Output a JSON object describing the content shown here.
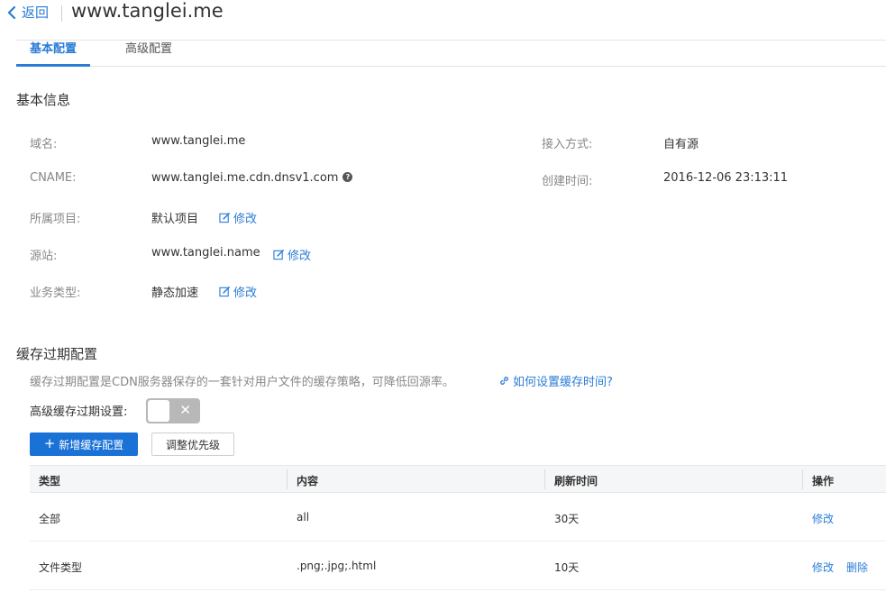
{
  "header": {
    "back_label": "返回",
    "title": "www.tanglei.me"
  },
  "tabs": [
    {
      "label": "基本配置",
      "active": true
    },
    {
      "label": "高级配置",
      "active": false
    }
  ],
  "basic_info": {
    "section_title": "基本信息",
    "domain_label": "域名:",
    "domain_value": "www.tanglei.me",
    "cname_label": "CNAME:",
    "cname_value": "www.tanglei.me.cdn.dnsv1.com",
    "project_label": "所属项目:",
    "project_value": "默认项目",
    "origin_label": "源站:",
    "origin_value": "www.tanglei.name",
    "service_label": "业务类型:",
    "service_value": "静态加速",
    "access_label": "接入方式:",
    "access_value": "自有源",
    "created_label": "创建时间:",
    "created_value": "2016-12-06 23:13:11",
    "edit_label": "修改"
  },
  "cache": {
    "section_title": "缓存过期配置",
    "description": "缓存过期配置是CDN服务器保存的一套针对用户文件的缓存策略，可降低回源率。",
    "help_link": "如何设置缓存时间?",
    "advanced_label": "高级缓存过期设置:",
    "advanced_enabled": false,
    "add_button": "新增缓存配置",
    "priority_button": "调整优先级",
    "table": {
      "headers": [
        "类型",
        "内容",
        "刷新时间",
        "操作"
      ],
      "rows": [
        {
          "type": "全部",
          "content": "all",
          "time": "30天",
          "edit": "修改",
          "delete": ""
        },
        {
          "type": "文件类型",
          "content": ".png;.jpg;.html",
          "time": "10天",
          "edit": "修改",
          "delete": "删除"
        }
      ]
    }
  },
  "colors": {
    "accent": "#2b7cd6",
    "primary_button": "#1a72d6",
    "toggle_off": "#b8b8b8"
  }
}
